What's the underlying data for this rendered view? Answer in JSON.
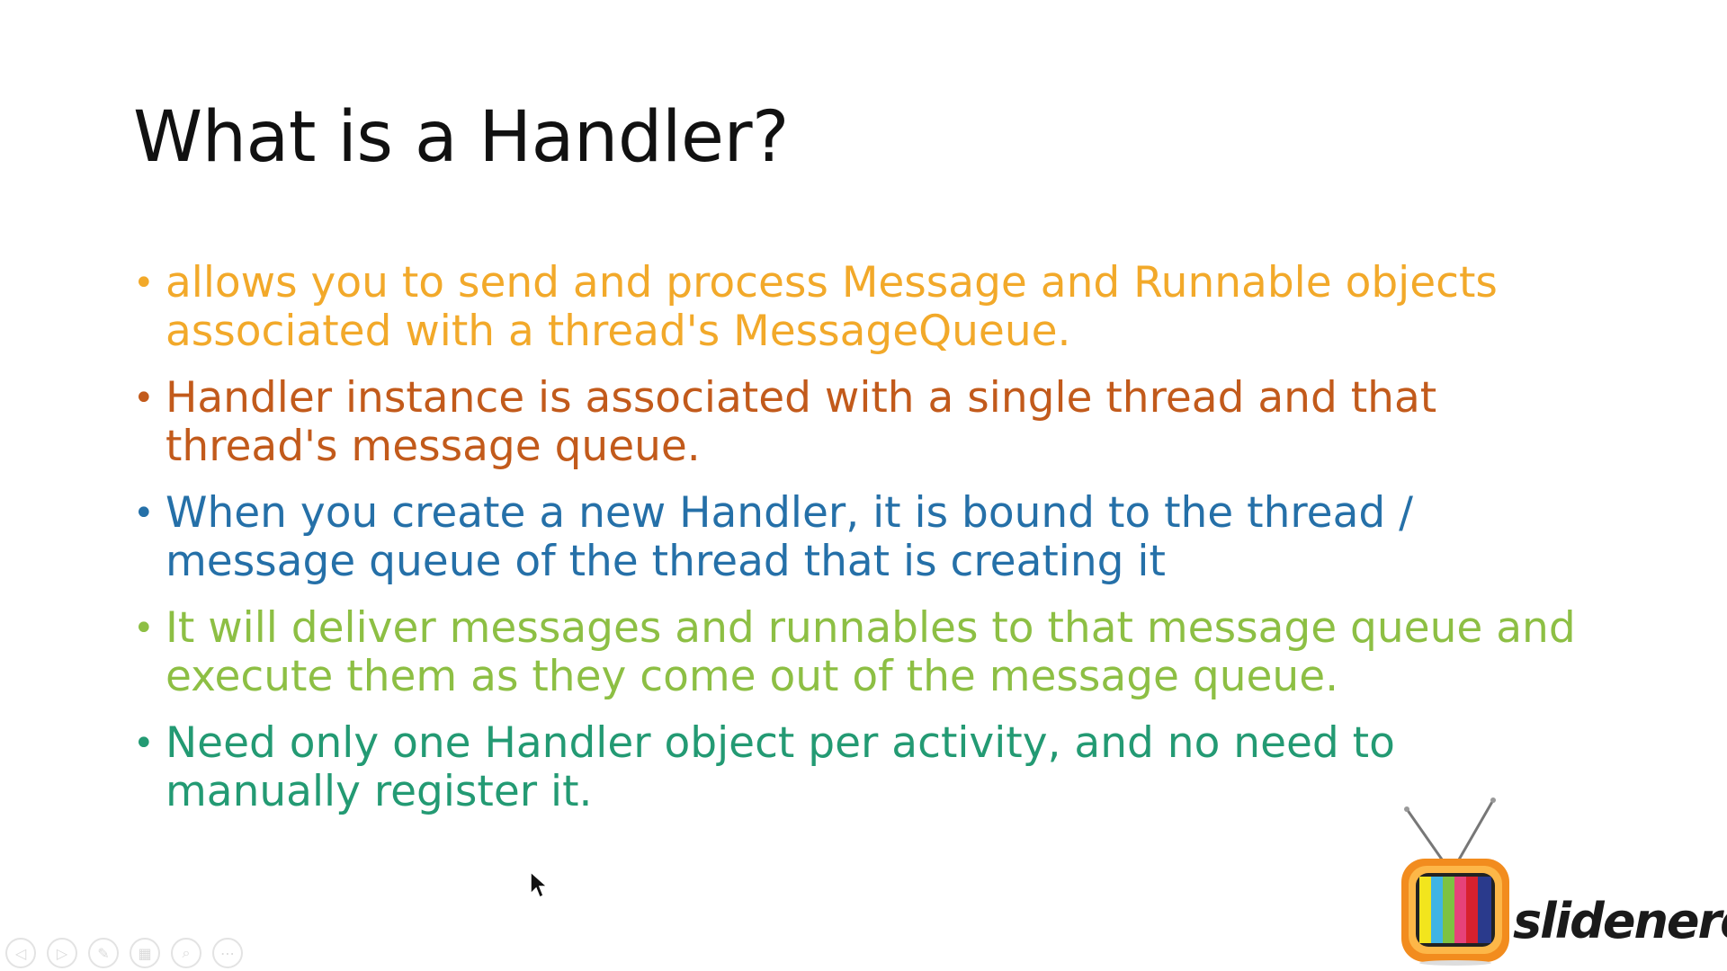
{
  "slide": {
    "title": "What is a Handler?",
    "bullets": [
      {
        "text": "allows you to send and process Message and Runnable objects associated with a thread's MessageQueue.",
        "color": "#F2A92A"
      },
      {
        "text": "Handler instance is associated with a single thread and that thread's message queue.",
        "color": "#C25A1B"
      },
      {
        "text": "When you create a new Handler, it is bound to the thread / message queue of the thread that is creating it",
        "color": "#2570A8"
      },
      {
        "text": "It will deliver messages and runnables to that message queue and execute them as they come out of the message queue.",
        "color": "#8DBF44"
      },
      {
        "text": "Need only one Handler object per activity, and no need to manually register it.",
        "color": "#239A73"
      }
    ]
  },
  "logo": {
    "brand_text": "slidenerd",
    "icon": "tv-icon"
  },
  "toolbar": {
    "buttons": [
      {
        "name": "previous-slide-button",
        "icon": "arrow-left-icon",
        "glyph": "◁"
      },
      {
        "name": "next-slide-button",
        "icon": "arrow-right-icon",
        "glyph": "▷"
      },
      {
        "name": "pen-tool-button",
        "icon": "pen-icon",
        "glyph": "✎"
      },
      {
        "name": "see-all-slides-button",
        "icon": "grid-icon",
        "glyph": "▦"
      },
      {
        "name": "zoom-button",
        "icon": "magnifier-icon",
        "glyph": "⌕"
      },
      {
        "name": "more-options-button",
        "icon": "ellipsis-icon",
        "glyph": "⋯"
      }
    ]
  }
}
